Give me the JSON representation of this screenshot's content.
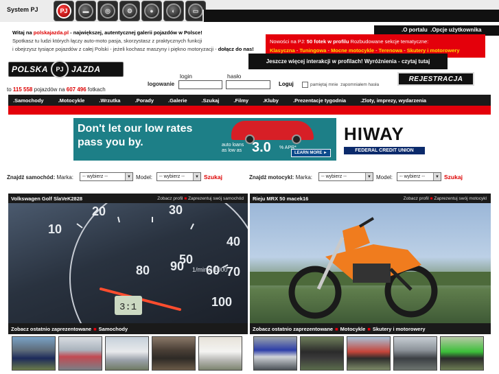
{
  "system": {
    "label": "System PJ",
    "icons": [
      "pj-logo-icon",
      "car-icon",
      "wheel-icon",
      "motorcycle-icon",
      "helmet-icon",
      "scooter-icon",
      "race-car-icon"
    ]
  },
  "userbar": {
    "portal": ".O portalu",
    "options": ".Opcje użytkownika"
  },
  "welcome": {
    "line1_pre": "Witaj na ",
    "site": "polskajazda.pl",
    "line1_post": " - największej, autentycznej galerii pojazdów w Polsce!",
    "line2": "Spotkasz tu ludzi których łączy auto-moto pasja, skorzystasz z praktycznych funkcji",
    "line3_pre": "i obejrzysz tysiące pojazdów z całej Polski - jeżeli kochasz maszyny i piękno motoryzacji - ",
    "line3_cta": "dołącz do nas!"
  },
  "news": {
    "prefix": "Nowości na PJ: ",
    "highlight": "50 fotek w profilu",
    "rest": "  Rozbudowane sekcje tematyczne:",
    "sections": [
      "Klasyczna",
      "Tuningowa",
      "Mocne motocykle",
      "Terenowa",
      "Skutery i motorowery"
    ]
  },
  "promo": "Jeszcze więcej interakcji w profilach! Wyróżnienia - czytaj tutaj",
  "logo": {
    "left": "POLSKA",
    "mid": "PJ",
    "right": "JAZDA"
  },
  "stats": {
    "pre": "to ",
    "vehicles": "115 558",
    "mid": " pojazdów na ",
    "photos": "607 496",
    "post": " fotkach"
  },
  "login": {
    "title": "logowanie",
    "login_label": "login",
    "password_label": "hasło",
    "submit": "Loguj",
    "remember": "pamiętaj mnie",
    "forgot": "zapomniałem hasła",
    "register": "REJESTRACJA"
  },
  "nav": [
    ".Samochody",
    ".Motocykle",
    ".Wrzutka",
    ".Porady",
    ".Galerie",
    ".Szukaj",
    ".Filmy",
    ".Kluby",
    ".Prezentacje tygodnia",
    ".Zloty, imprezy, wydarzenia"
  ],
  "banner": {
    "line1": "Don't let our low rates",
    "line2": "pass you by.",
    "small1": "auto loans",
    "small2": "as low as",
    "rate": "3.0",
    "apr": "% APR*",
    "learn": "LEARN MORE ►",
    "brand": "HIWAY",
    "brand_sub": "FEDERAL CREDIT UNION"
  },
  "search_car": {
    "title": "Znajdź samochód:",
    "brand_label": "Marka:",
    "brand_value": "-- wybierz --",
    "model_label": "Model:",
    "model_value": "-- wybierz --",
    "submit": "Szukaj"
  },
  "search_moto": {
    "title": "Znajdź motocykl:",
    "brand_label": "Marka:",
    "brand_value": "-- wybierz --",
    "model_label": "Model:",
    "model_value": "-- wybierz --",
    "submit": "Szukaj"
  },
  "car_panel": {
    "title": "Volkswagen Golf   SlaVeK2828",
    "profile": "Zobacz profil",
    "present": "Zaprezentuj swój samochód",
    "footer_pre": "Zobacz ostatnio zaprezentowane",
    "footer_cat": "Samochody"
  },
  "moto_panel": {
    "title": "Rieju MRX 50   macek16",
    "profile": "Zobacz profil",
    "present": "Zaprezentuj swój motocykl",
    "footer_pre": "Zobacz ostatnio zaprezentowane",
    "footer_cat1": "Motocykle",
    "footer_cat2": "Skutery i motorowery"
  },
  "gauge": {
    "scale": [
      "10",
      "20",
      "30",
      "40",
      "50",
      "60",
      "70",
      "80",
      "90",
      "100"
    ],
    "unit": "1/min x 1000",
    "odo": "3:1"
  },
  "colors": {
    "accent_red": "#e4000b",
    "dark": "#1a1a1a",
    "banner_teal": "#1d7f87"
  }
}
